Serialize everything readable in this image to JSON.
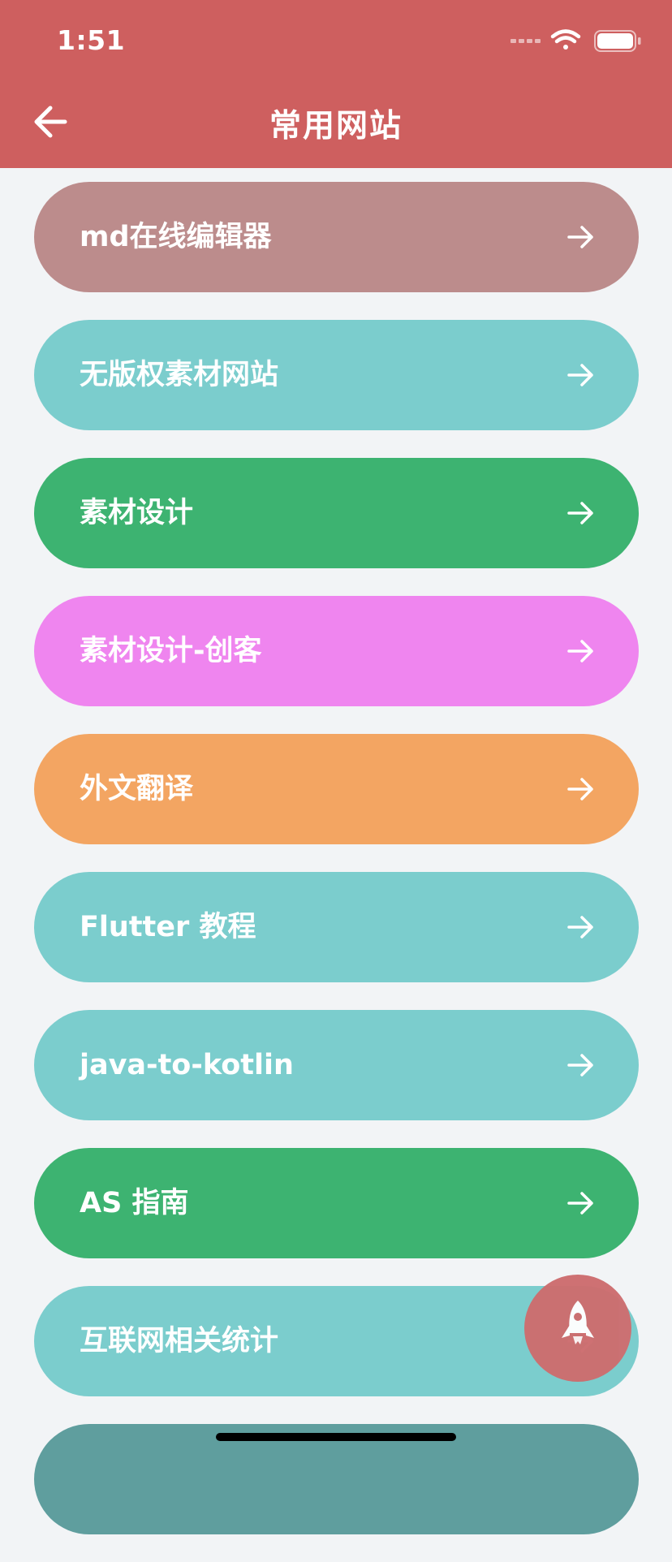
{
  "status_bar": {
    "time": "1:51"
  },
  "app_bar": {
    "title": "常用网站",
    "back_icon": "arrow-back-icon",
    "background": "#ce5f5f"
  },
  "list": {
    "items": [
      {
        "label": "md在线编辑器",
        "color": "#bc8c8c"
      },
      {
        "label": "无版权素材网站",
        "color": "#7bcdcd"
      },
      {
        "label": "素材设计",
        "color": "#3db371"
      },
      {
        "label": "素材设计-创客",
        "color": "#ef85ef"
      },
      {
        "label": "外文翻译",
        "color": "#f3a562"
      },
      {
        "label": "Flutter 教程",
        "color": "#7bcdcd"
      },
      {
        "label": "java-to-kotlin",
        "color": "#7bcdcd"
      },
      {
        "label": "AS 指南",
        "color": "#3db371"
      },
      {
        "label": "互联网相关统计",
        "color": "#7bcdcd"
      },
      {
        "label": "",
        "color": "#5f9e9e"
      }
    ],
    "arrow_icon": "arrow-forward-icon"
  },
  "fab": {
    "icon": "rocket-icon",
    "color": "#cd6d6f"
  }
}
